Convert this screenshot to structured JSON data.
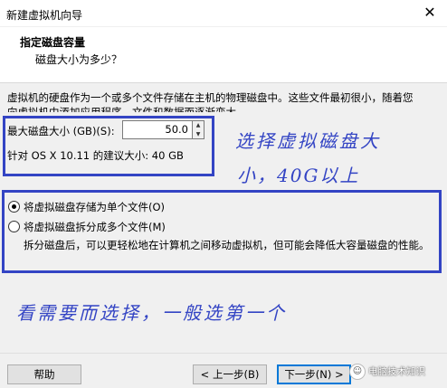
{
  "window": {
    "title": "新建虚拟机向导",
    "close_glyph": "✕"
  },
  "header": {
    "title": "指定磁盘容量",
    "subtitle": "磁盘大小为多少？"
  },
  "description": {
    "line1": "虚拟机的硬盘作为一个或多个文件存储在主机的物理磁盘中。这些文件最初很小，随着您",
    "line2": "向虚拟机中添加应用程序、文件和数据而逐渐变大。"
  },
  "disk_size": {
    "label": "最大磁盘大小 (GB)(S):",
    "value": "50.0",
    "recommend": "针对 OS X 10.11 的建议大小: 40 GB"
  },
  "storage_options": [
    {
      "label": "将虚拟磁盘存储为单个文件(O)",
      "checked": true
    },
    {
      "label": "将虚拟磁盘拆分成多个文件(M)",
      "checked": false
    }
  ],
  "split_description": "拆分磁盘后，可以更轻松地在计算机之间移动虚拟机，但可能会降低大容量磁盘的性能。",
  "annotations": {
    "note1": "选择虚拟磁盘大",
    "note2": "小，40G以上",
    "note3": "看需要而选择，一般选第一个"
  },
  "buttons": {
    "help": "帮助",
    "back": "< 上一步(B)",
    "next": "下一步(N) >"
  },
  "watermark": "电脑技术知识",
  "colors": {
    "annotation": "#3344c4",
    "default_button_border": "#0078d7"
  }
}
